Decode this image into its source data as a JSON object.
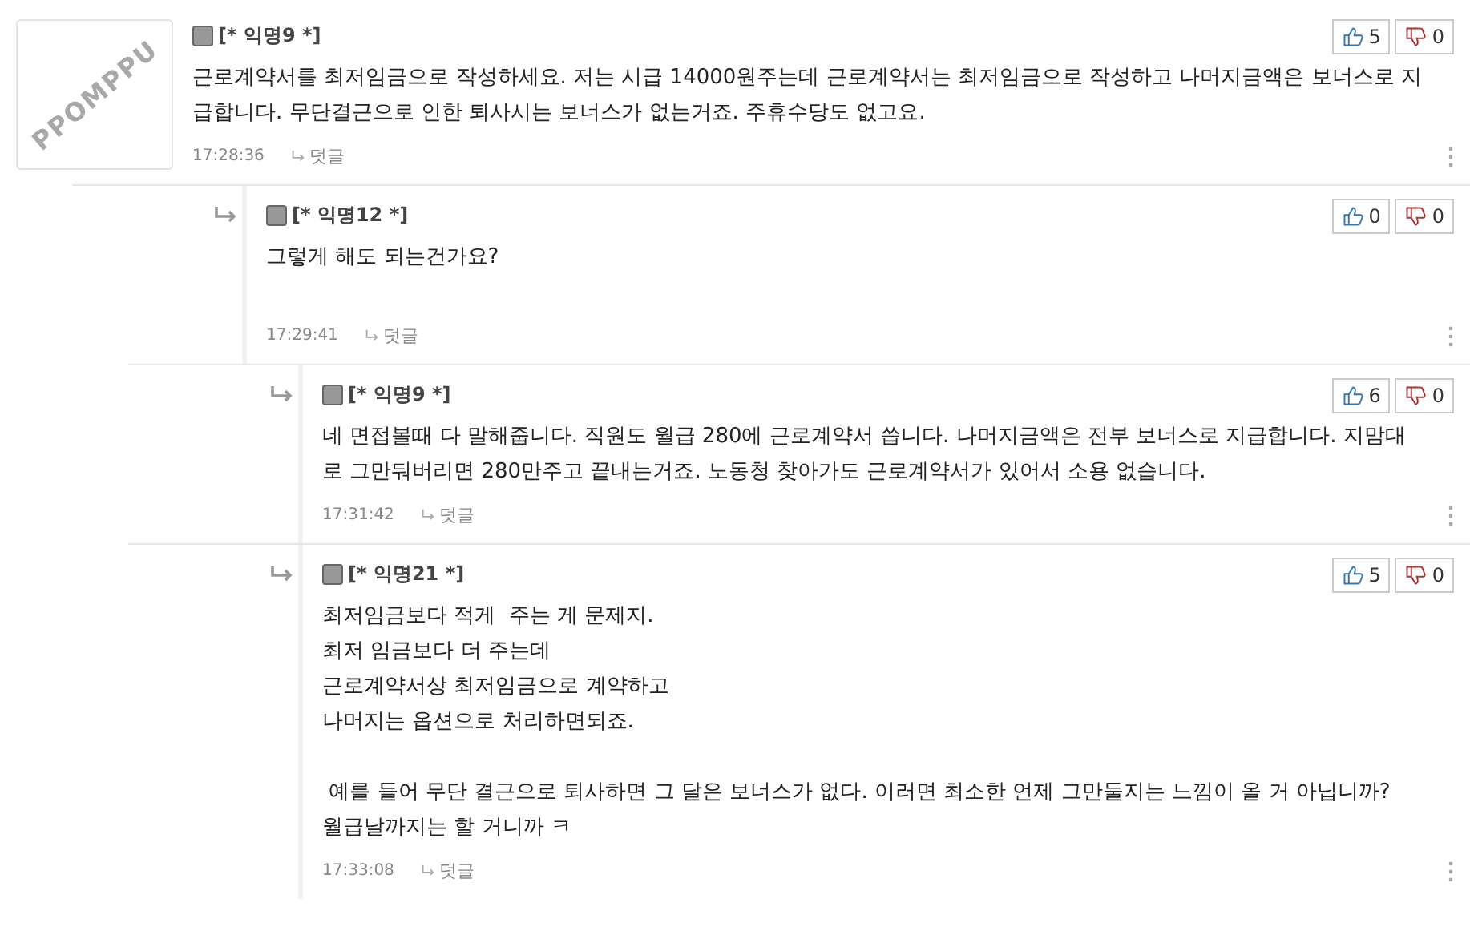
{
  "comments": [
    {
      "author": "[* 익명9 *]",
      "avatar_text": "PPOMPPU",
      "body": "근로계약서를 최저임금으로 작성하세요. 저는 시급 14000원주는데 근로계약서는 최저임금으로 작성하고 나머지금액은 보너스로 지급합니다. 무단결근으로 인한 퇴사시는 보너스가 없는거죠. 주휴수당도 없고요.",
      "time": "17:28:36",
      "reply_label": "덧글",
      "likes": "5",
      "dislikes": "0",
      "children": [
        {
          "author": "[* 익명12 *]",
          "body": "그렇게 해도 되는건가요?",
          "time": "17:29:41",
          "reply_label": "덧글",
          "likes": "0",
          "dislikes": "0",
          "children": [
            {
              "author": "[* 익명9 *]",
              "body": "네 면접볼때 다 말해줍니다. 직원도 월급 280에 근로계약서 씁니다. 나머지금액은 전부 보너스로 지급합니다. 지맘대로 그만둬버리면 280만주고 끝내는거죠. 노동청 찾아가도 근로계약서가 있어서 소용 없습니다.",
              "time": "17:31:42",
              "reply_label": "덧글",
              "likes": "6",
              "dislikes": "0"
            },
            {
              "author": "[* 익명21 *]",
              "body": "최저임금보다 적게  주는 게 문제지.\n최저 임금보다 더 주는데\n근로계약서상 최저임금으로 계약하고\n나머지는 옵션으로 처리하면되죠.\n\n 예를 들어 무단 결근으로 퇴사하면 그 달은 보너스가 없다. 이러면 최소한 언제 그만둘지는 느낌이 올 거 아닙니까?\n월급날까지는 할 거니까 ㅋ",
              "time": "17:33:08",
              "reply_label": "덧글",
              "likes": "5",
              "dislikes": "0"
            }
          ]
        }
      ]
    }
  ]
}
